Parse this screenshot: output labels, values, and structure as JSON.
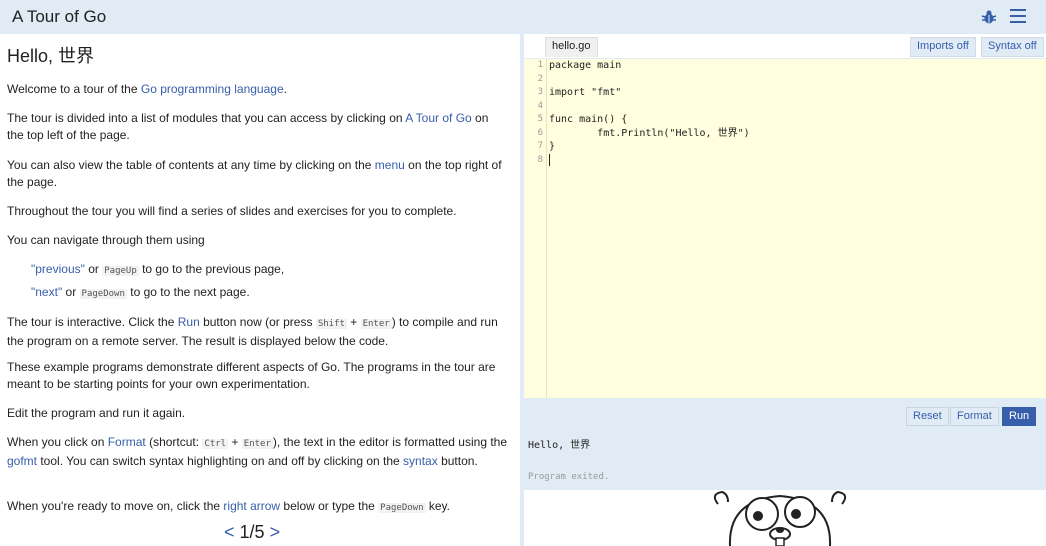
{
  "header": {
    "title": "A Tour of Go",
    "bug_icon": "bug-icon",
    "menu_icon": "hamburger-menu-icon"
  },
  "lesson": {
    "title": "Hello, 世界",
    "p1_pre": "Welcome to a tour of the ",
    "p1_link": "Go programming language",
    "p1_post": ".",
    "p2_pre": "The tour is divided into a list of modules that you can access by clicking on ",
    "p2_link": "A Tour of Go",
    "p2_post": " on the top left of the page.",
    "p3_pre": "You can also view the table of contents at any time by clicking on the ",
    "p3_link": "menu",
    "p3_post": " on the top right of the page.",
    "p4": "Throughout the tour you will find a series of slides and exercises for you to complete.",
    "p5": "You can navigate through them using",
    "li1_link": "\"previous\"",
    "li1_mid": " or ",
    "li1_key": "PageUp",
    "li1_post": " to go to the previous page,",
    "li2_link": "\"next\"",
    "li2_mid": " or ",
    "li2_key": "PageDown",
    "li2_post": " to go to the next page.",
    "p6_pre": "The tour is interactive. Click the ",
    "p6_link": "Run",
    "p6_mid": " button now (or press ",
    "p6_key1": "Shift",
    "p6_plus": " + ",
    "p6_key2": "Enter",
    "p6_post": ") to compile and run the program on a remote server. The result is displayed below the code.",
    "p7": "These example programs demonstrate different aspects of Go. The programs in the tour are meant to be starting points for your own experimentation.",
    "p8": "Edit the program and run it again.",
    "p9_pre": "When you click on ",
    "p9_link1": "Format",
    "p9_mid1": " (shortcut: ",
    "p9_key1": "Ctrl",
    "p9_plus": " + ",
    "p9_key2": "Enter",
    "p9_mid2": "), the text in the editor is formatted using the ",
    "p9_link2": "gofmt",
    "p9_mid3": " tool. You can switch syntax highlighting on and off by clicking on the ",
    "p9_link3": "syntax",
    "p9_post": " button.",
    "p10_pre": "When you're ready to move on, click the ",
    "p10_link": "right arrow",
    "p10_mid": " below or type the ",
    "p10_key": "PageDown",
    "p10_post": " key.",
    "nav_prev": "<",
    "nav_page": "1/5",
    "nav_next": ">"
  },
  "editor": {
    "tab": "hello.go",
    "imports_btn": "Imports off",
    "syntax_btn": "Syntax off",
    "line_numbers": [
      "1",
      "2",
      "3",
      "4",
      "5",
      "6",
      "7",
      "8"
    ],
    "lines": [
      "package main",
      "",
      "import \"fmt\"",
      "",
      "func main() {",
      "\tfmt.Println(\"Hello, 世界\")",
      "}",
      ""
    ]
  },
  "output": {
    "reset_btn": "Reset",
    "format_btn": "Format",
    "run_btn": "Run",
    "result": "Hello, 世界",
    "status": "Program exited."
  },
  "colors": {
    "accent": "#375eab",
    "panel": "#e0ebf5",
    "editor_bg": "#ffffe0"
  }
}
